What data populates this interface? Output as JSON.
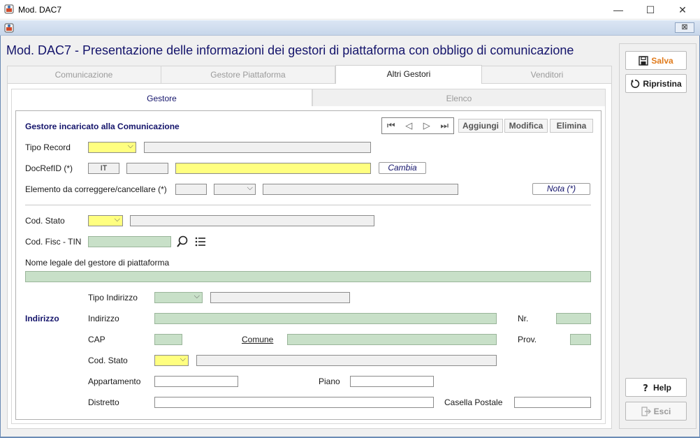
{
  "window": {
    "title": "Mod. DAC7",
    "minimize": "—",
    "maximize": "☐",
    "close": "✕",
    "inner_close": "⊠"
  },
  "heading": "Mod. DAC7 - Presentazione delle informazioni dei gestori di piattaforma con obbligo di comunicazione",
  "tabs": [
    "Comunicazione",
    "Gestore Piattaforma",
    "Altri Gestori",
    "Venditori"
  ],
  "subtabs": [
    "Gestore",
    "Elenco"
  ],
  "section_title": "Gestore incaricato alla Comunicazione",
  "nav": {
    "first": "⏮",
    "prev": "◁",
    "next": "▷",
    "last": "⏭"
  },
  "actions": {
    "add": "Aggiungi",
    "edit": "Modifica",
    "delete": "Elimina"
  },
  "labels": {
    "tipo_record": "Tipo Record",
    "docrefid": "DocRefID (*)",
    "elemento": "Elemento da correggere/cancellare (*)",
    "cod_stato": "Cod. Stato",
    "cod_fisc": "Cod. Fisc - TIN",
    "nome_legale": "Nome legale del gestore di piattaforma",
    "indirizzo_sec": "Indirizzo",
    "tipo_indirizzo": "Tipo Indirizzo",
    "indirizzo": "Indirizzo",
    "nr": "Nr.",
    "cap": "CAP",
    "comune": "Comune",
    "prov": "Prov.",
    "cod_stato2": "Cod. Stato",
    "appartamento": "Appartamento",
    "piano": "Piano",
    "distretto": "Distretto",
    "casella": "Casella Postale"
  },
  "values": {
    "docref_country": "IT"
  },
  "buttons": {
    "cambia": "Cambia",
    "nota": "Nota (*)"
  },
  "side": {
    "salva": "Salva",
    "ripristina": "Ripristina",
    "help": "Help",
    "esci": "Esci"
  },
  "colors": {
    "heading": "#14146b",
    "salva": "#e07a1a",
    "yellow_field": "#ffff80",
    "green_field": "#c8e0c8"
  }
}
